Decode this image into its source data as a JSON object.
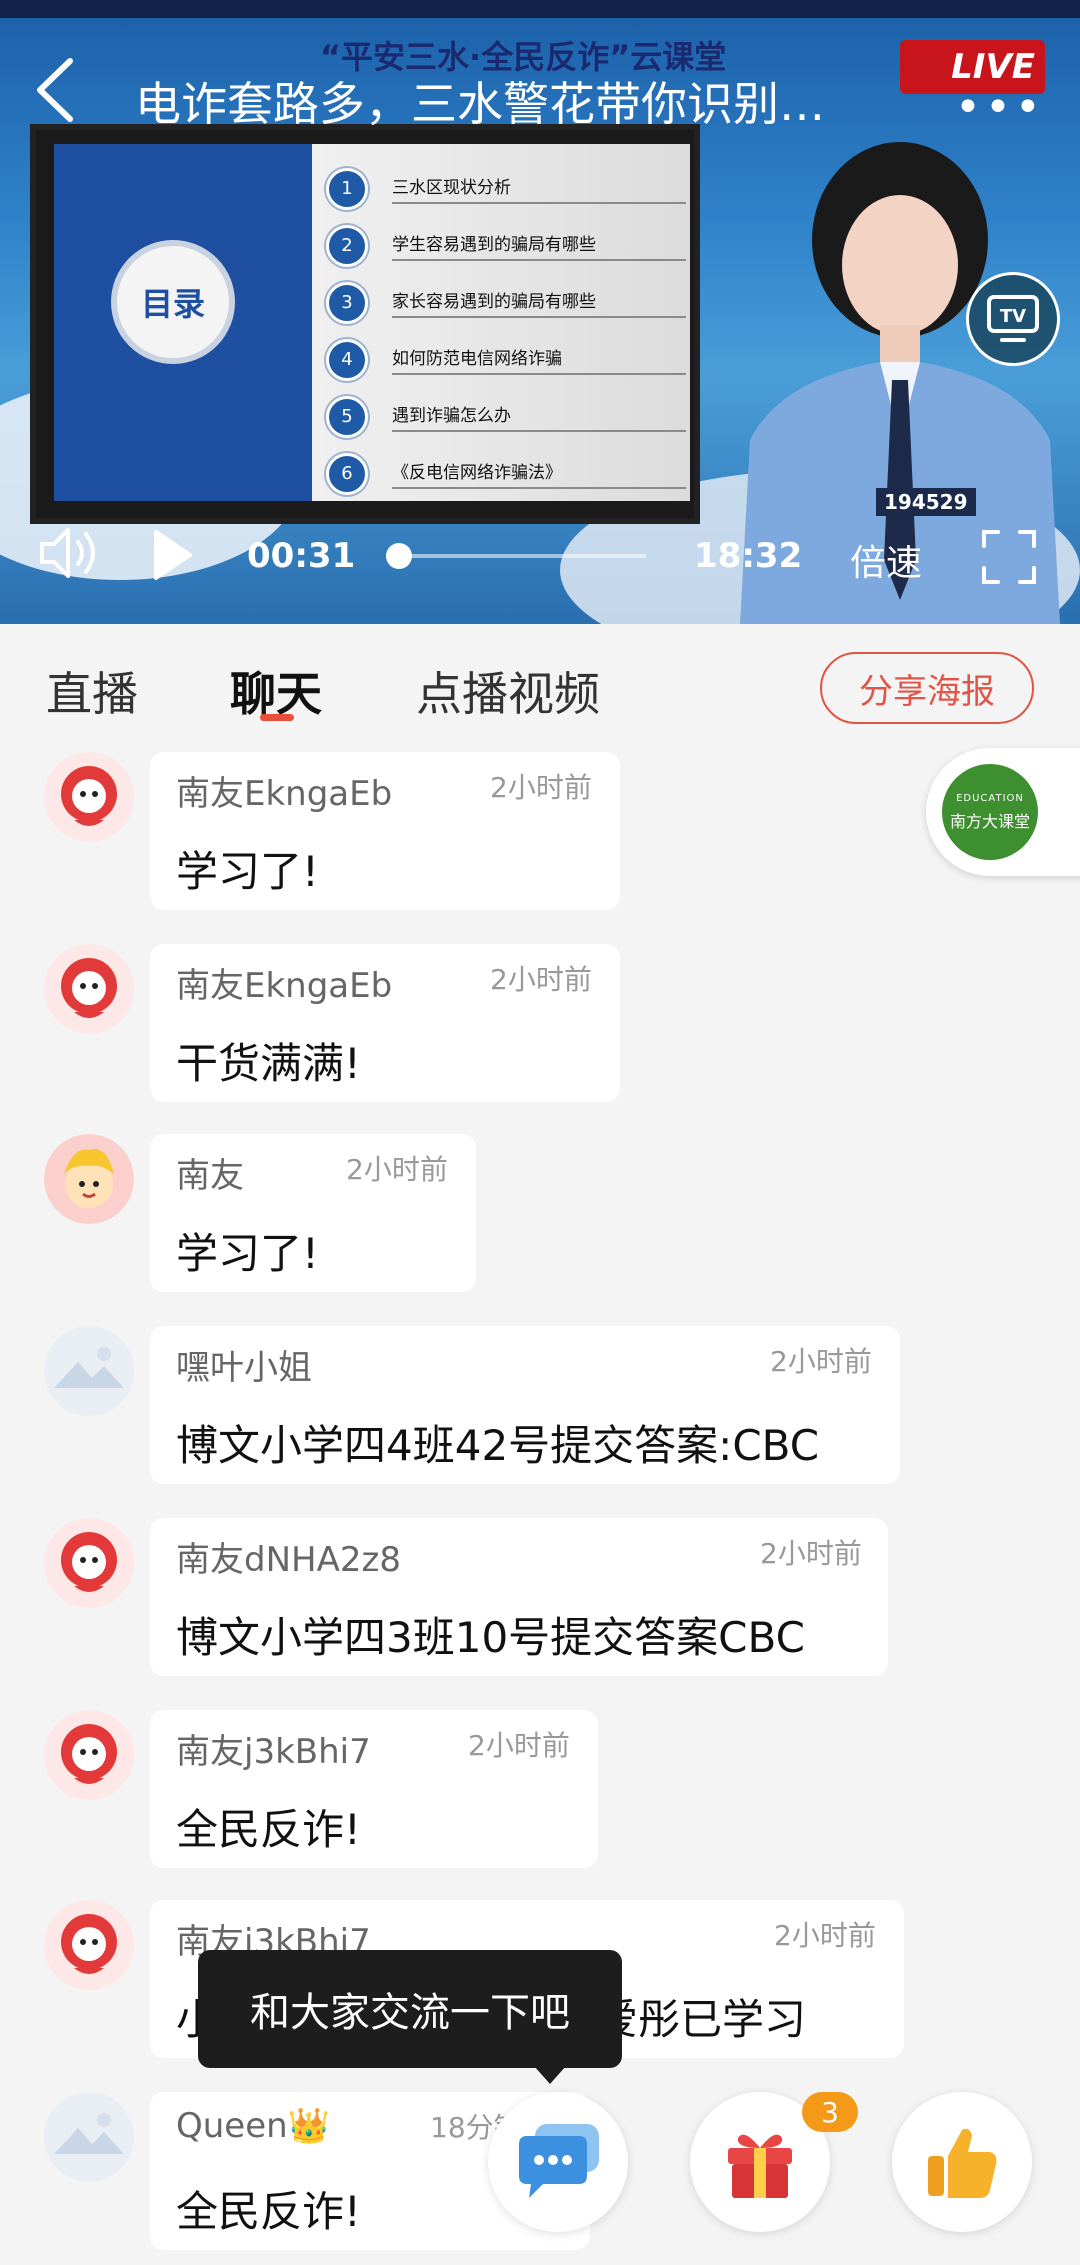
{
  "video": {
    "title": "电诈套路多，三水警花带你识别…",
    "event_title": "“平安三水·全民反诈”云课堂",
    "live_logo": "LIVE",
    "more_label": "•••",
    "slide": {
      "heading": "目录",
      "items": [
        {
          "num": "1",
          "text": "三水区现状分析"
        },
        {
          "num": "2",
          "text": "学生容易遇到的骗局有哪些"
        },
        {
          "num": "3",
          "text": "家长容易遇到的骗局有哪些"
        },
        {
          "num": "4",
          "text": "如何防范电信网络诈骗"
        },
        {
          "num": "5",
          "text": "遇到诈骗怎么办"
        },
        {
          "num": "6",
          "text": "《反电信网络诈骗法》"
        }
      ]
    },
    "badge_number": "194529",
    "current_time": "00:31",
    "duration": "18:32",
    "progress": 0.03,
    "speed_label": "倍速"
  },
  "tabs": [
    {
      "label": "直播"
    },
    {
      "label": "聊天"
    },
    {
      "label": "点播视频"
    }
  ],
  "active_tab": "聊天",
  "share_button": "分享海报",
  "edu_badge": {
    "line1": "EDUCATION",
    "line2": "南方大课堂"
  },
  "messages": [
    {
      "name": "南友EkngaEb",
      "time": "2小时前",
      "text": "学习了!"
    },
    {
      "name": "南友EkngaEb",
      "time": "2小时前",
      "text": "干货满满!"
    },
    {
      "name": "南友",
      "time": "2小时前",
      "text": "学习了!"
    },
    {
      "name": "嘿叶小姐",
      "time": "2小时前",
      "text": "博文小学四4班42号提交答案:CBC"
    },
    {
      "name": "南友dNHA2z8",
      "time": "2小时前",
      "text": "博文小学四3班10号提交答案CBC"
    },
    {
      "name": "南友j3kBhi7",
      "time": "2小时前",
      "text": "全民反诈!"
    },
    {
      "name": "南友j3kBhi7",
      "time": "2小时前",
      "text": "小天和宝宝四小四班周爱彤已学习"
    },
    {
      "name": "Queen👑",
      "time": "18分钟",
      "text": "全民反诈!"
    }
  ],
  "tooltip": "和大家交流一下吧",
  "gift_count": "3",
  "colors": {
    "accent": "#e05545",
    "live_red": "#c8141b",
    "badge_orange": "#f59a18"
  }
}
